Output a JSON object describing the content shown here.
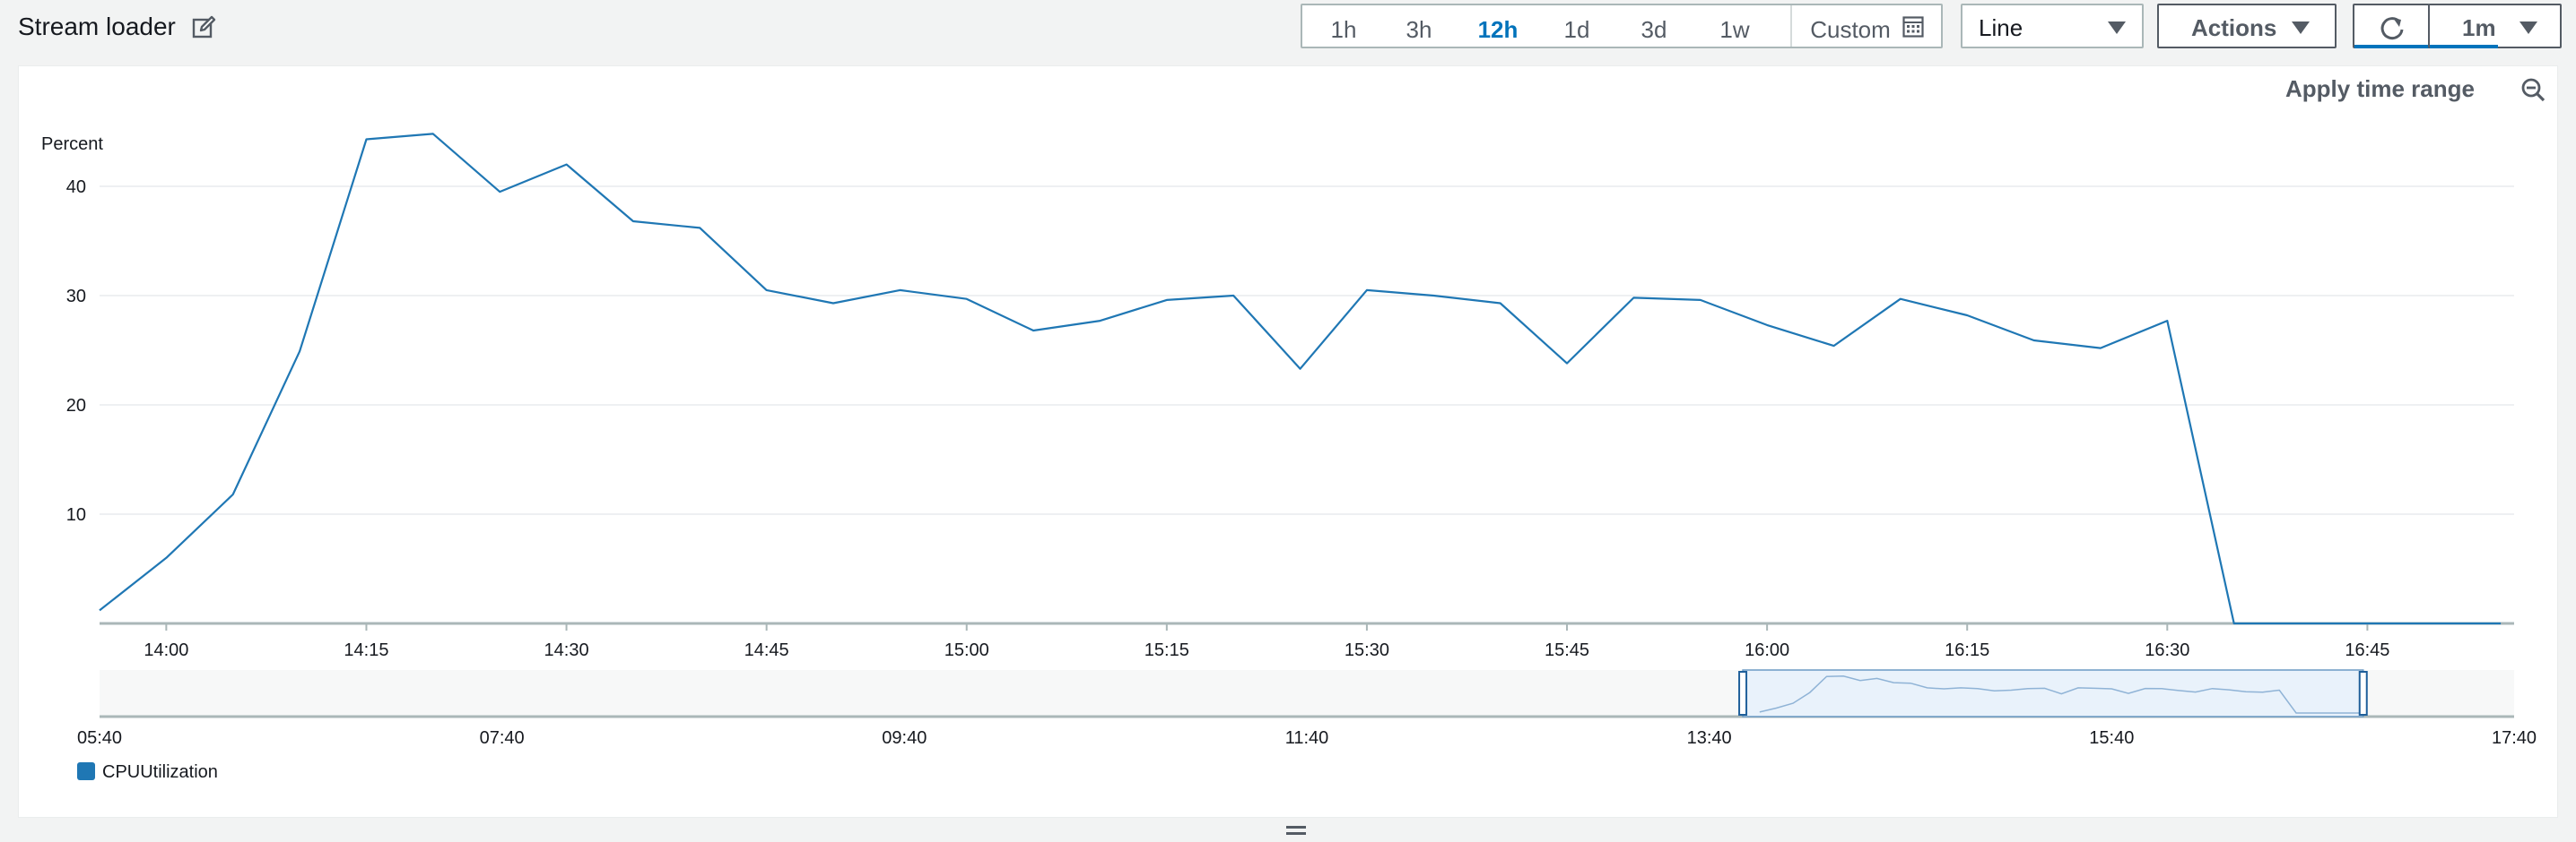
{
  "widget": {
    "title": "Stream loader"
  },
  "toolbar": {
    "ranges": [
      "1h",
      "3h",
      "12h",
      "1d",
      "3d",
      "1w"
    ],
    "active_range": "12h",
    "custom_label": "Custom",
    "view_type": "Line",
    "actions_label": "Actions",
    "refresh_interval": "1m"
  },
  "panel": {
    "apply_time_range": "Apply time range"
  },
  "icons": {
    "edit": "edit-icon",
    "calendar": "calendar-icon",
    "caret": "caret-down-icon",
    "refresh": "refresh-icon",
    "zoom_out": "zoom-out-icon",
    "resize": "resize-handle-icon"
  },
  "colors": {
    "series": "#1f77b4",
    "active_range": "#0073bb"
  },
  "chart_data": {
    "type": "line",
    "ylabel": "Percent",
    "ylim": [
      0,
      50
    ],
    "yticks": [
      10,
      20,
      30,
      40
    ],
    "x_tick_labels": [
      "14:00",
      "14:15",
      "14:30",
      "14:45",
      "15:00",
      "15:15",
      "15:30",
      "15:45",
      "16:00",
      "16:15",
      "16:30",
      "16:45"
    ],
    "x_start_min": 835,
    "x_end_min": 1016,
    "grid": true,
    "series": [
      {
        "name": "CPUUtilization",
        "color": "#1f77b4",
        "x": [
          "13:55",
          "14:00",
          "14:05",
          "14:10",
          "14:15",
          "14:20",
          "14:25",
          "14:30",
          "14:35",
          "14:40",
          "14:45",
          "14:50",
          "14:55",
          "15:00",
          "15:05",
          "15:10",
          "15:15",
          "15:20",
          "15:25",
          "15:30",
          "15:35",
          "15:40",
          "15:45",
          "15:50",
          "15:55",
          "16:00",
          "16:05",
          "16:10",
          "16:15",
          "16:20",
          "16:25",
          "16:30",
          "16:35",
          "16:40",
          "16:45",
          "16:50",
          "16:55"
        ],
        "values": [
          1.2,
          6.0,
          11.8,
          24.9,
          44.3,
          44.8,
          39.5,
          42.0,
          36.8,
          36.2,
          30.5,
          29.3,
          30.5,
          29.7,
          26.8,
          27.7,
          29.6,
          30.0,
          23.3,
          30.5,
          30.0,
          29.3,
          23.8,
          29.8,
          29.6,
          27.3,
          25.4,
          29.7,
          28.2,
          25.9,
          25.2,
          27.7,
          0,
          0,
          0,
          0,
          0
        ]
      }
    ],
    "overview": {
      "x_tick_labels": [
        "05:40",
        "07:40",
        "09:40",
        "11:40",
        "13:40",
        "15:40",
        "17:40"
      ],
      "x_start_min": 340,
      "x_end_min": 1060,
      "selection_start_min": 830,
      "selection_end_min": 1015
    },
    "legend": {
      "position": "bottom-left",
      "entries": [
        "CPUUtilization"
      ]
    }
  }
}
